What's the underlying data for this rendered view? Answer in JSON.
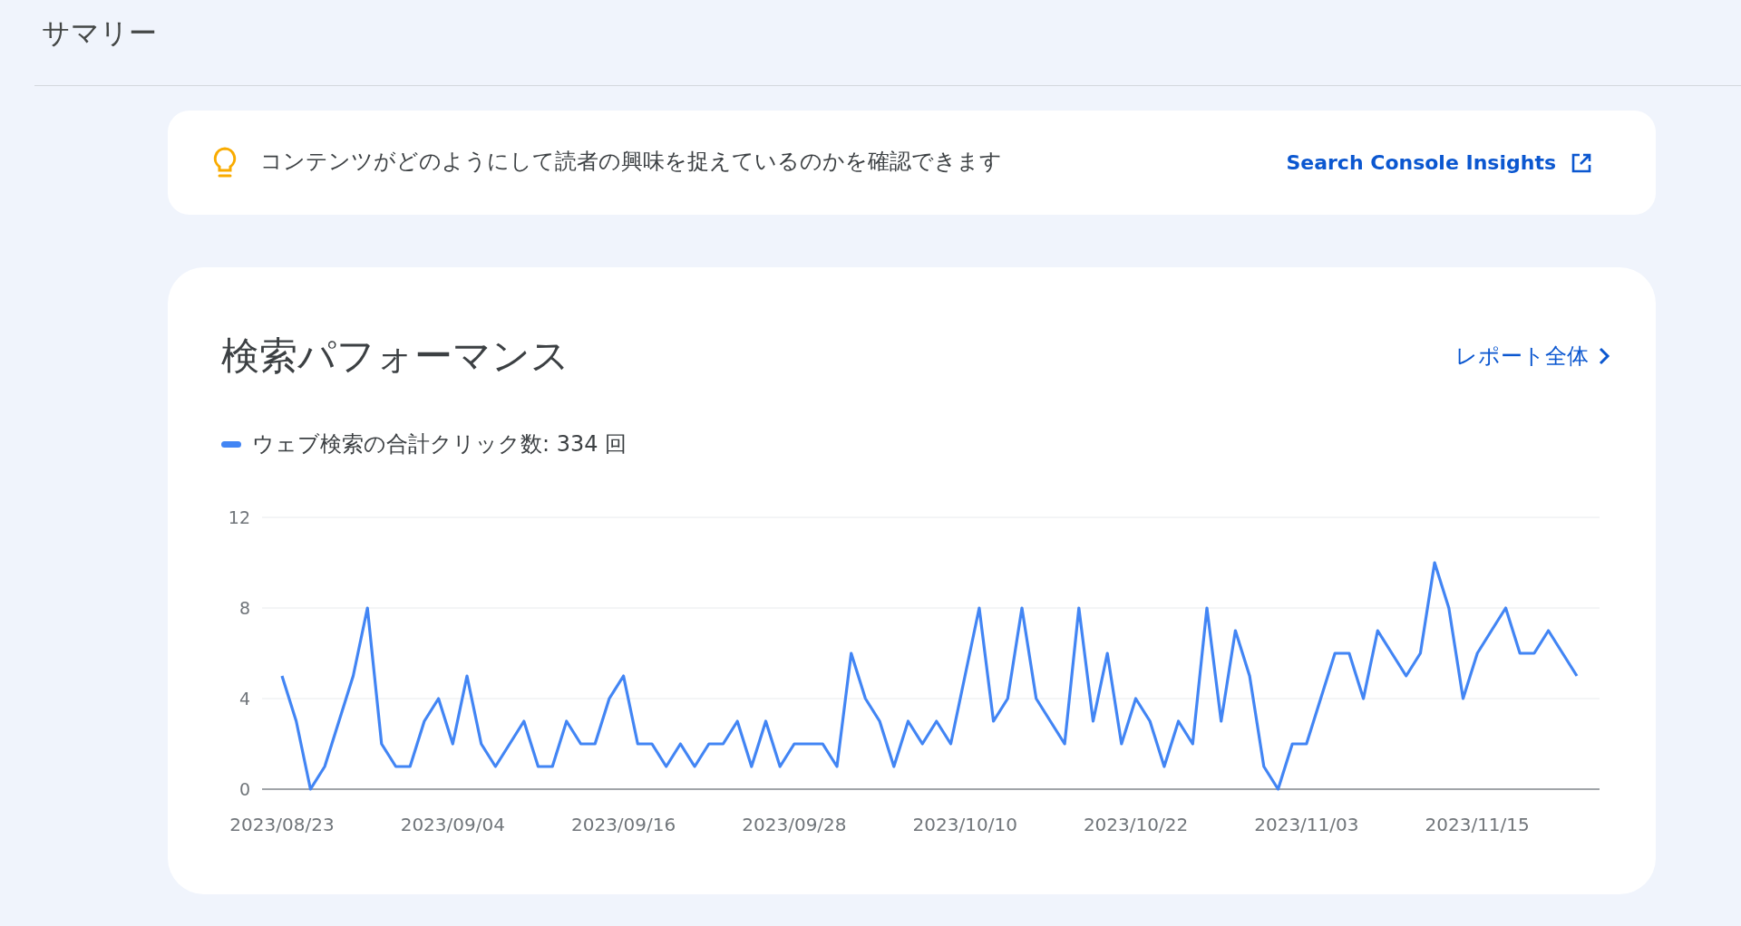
{
  "page_title": "サマリー",
  "insight": {
    "text": "コンテンツがどのようにして読者の興味を捉えているのかを確認できます",
    "link": "Search Console Insights"
  },
  "performance": {
    "title": "検索パフォーマンス",
    "report_link": "レポート全体",
    "legend_total": ": 334 回",
    "chart_data": {
      "type": "line",
      "ylim": [
        0,
        12
      ],
      "yticks": [
        0,
        4,
        8,
        12
      ],
      "categories": [
        "2023/08/23",
        null,
        null,
        null,
        null,
        null,
        null,
        null,
        null,
        null,
        null,
        null,
        "2023/09/04",
        null,
        null,
        null,
        null,
        null,
        null,
        null,
        null,
        null,
        null,
        null,
        "2023/09/16",
        null,
        null,
        null,
        null,
        null,
        null,
        null,
        null,
        null,
        null,
        null,
        "2023/09/28",
        null,
        null,
        null,
        null,
        null,
        null,
        null,
        null,
        null,
        null,
        null,
        "2023/10/10",
        null,
        null,
        null,
        null,
        null,
        null,
        null,
        null,
        null,
        null,
        null,
        "2023/10/22",
        null,
        null,
        null,
        null,
        null,
        null,
        null,
        null,
        null,
        null,
        null,
        "2023/11/03",
        null,
        null,
        null,
        null,
        null,
        null,
        null,
        null,
        null,
        null,
        null,
        "2023/11/15",
        null,
        null,
        null,
        null,
        null,
        null,
        null
      ],
      "series": [
        {
          "name": "ウェブ検索の合計クリック数",
          "color": "#4285f4",
          "values": [
            5,
            3,
            0,
            1,
            3,
            5,
            8,
            2,
            1,
            1,
            3,
            4,
            2,
            5,
            2,
            1,
            2,
            3,
            1,
            1,
            3,
            2,
            2,
            4,
            5,
            2,
            2,
            1,
            2,
            1,
            2,
            2,
            3,
            1,
            3,
            1,
            2,
            2,
            2,
            1,
            6,
            4,
            3,
            1,
            3,
            2,
            3,
            2,
            5,
            8,
            3,
            4,
            8,
            4,
            3,
            2,
            8,
            3,
            6,
            2,
            4,
            3,
            1,
            3,
            2,
            8,
            3,
            7,
            5,
            1,
            0,
            2,
            2,
            4,
            6,
            6,
            4,
            7,
            6,
            5,
            6,
            10,
            8,
            4,
            6,
            7,
            8,
            6,
            6,
            7,
            6,
            5
          ]
        }
      ]
    }
  }
}
